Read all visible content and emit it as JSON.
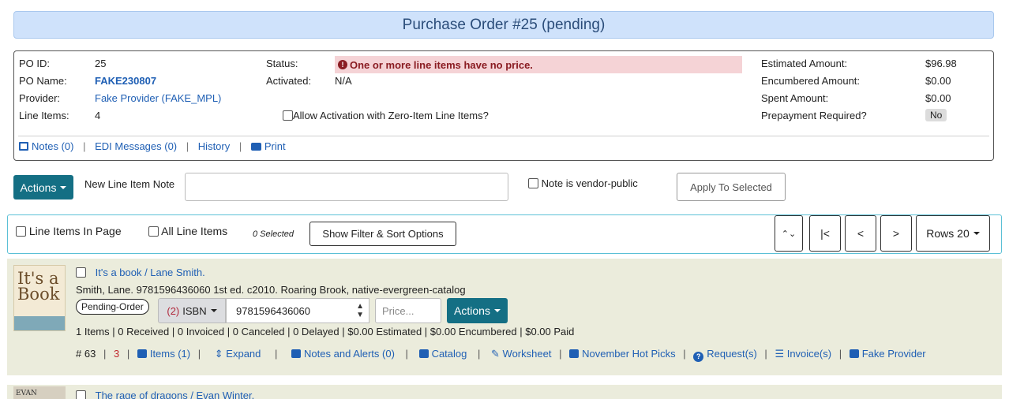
{
  "header": {
    "title": "Purchase Order #25 (pending)"
  },
  "summary": {
    "po_id_label": "PO ID:",
    "po_id": "25",
    "po_name_label": "PO Name:",
    "po_name": "FAKE230807",
    "provider_label": "Provider:",
    "provider": "Fake Provider (FAKE_MPL)",
    "line_items_label": "Line Items:",
    "line_items": "4",
    "status_label": "Status:",
    "status_alert": "One or more line items have no price.",
    "activated_label": "Activated:",
    "activated": "N/A",
    "allow_zero_label": "Allow Activation with Zero-Item Line Items?",
    "estimated_label": "Estimated Amount:",
    "estimated": "$96.98",
    "encumbered_label": "Encumbered Amount:",
    "encumbered": "$0.00",
    "spent_label": "Spent Amount:",
    "spent": "$0.00",
    "prepay_label": "Prepayment Required?",
    "prepay": "No",
    "links": {
      "notes": "Notes (0)",
      "edi": "EDI Messages (0)",
      "history": "History",
      "print": "Print"
    }
  },
  "actions_bar": {
    "actions_label": "Actions",
    "note_label": "New Line Item Note",
    "vendor_public_label": "Note is vendor-public",
    "apply_label": "Apply To Selected"
  },
  "toolbar": {
    "line_items_in_page": "Line Items In Page",
    "all_line_items": "All Line Items",
    "selected": "0 Selected",
    "filter_btn": "Show Filter & Sort Options",
    "expand_glyph": "⌃⌄",
    "first_glyph": "|<",
    "prev_glyph": "<",
    "next_glyph": ">",
    "rows_label": "Rows 20"
  },
  "line_items": [
    {
      "title": "It's a book / Lane Smith.",
      "cover_text": "It's a Book",
      "details": "Smith, Lane. 9781596436060  1st ed. c2010. Roaring Brook, native-evergreen-catalog",
      "state": "Pending-Order",
      "isbn_count": "(2)",
      "isbn_type": "ISBN",
      "isbn_value": "9781596436060",
      "price_placeholder": "Price...",
      "actions_label": "Actions",
      "stats": "1 Items  |  0 Received  |  0 Invoiced  |  0 Canceled  |  0 Delayed  |  $0.00 Estimated  |  $0.00 Encumbered  |  $0.00 Paid",
      "li_id": "# 63",
      "li_count": "3",
      "items_link": "Items (1)",
      "expand_link": "Expand",
      "notes_link": "Notes and Alerts (0)",
      "catalog_link": "Catalog",
      "worksheet_link": "Worksheet",
      "hot_picks_link": "November Hot Picks",
      "requests_link": "Request(s)",
      "invoices_link": "Invoice(s)",
      "provider_link": "Fake Provider"
    },
    {
      "title": "The rage of dragons / Evan Winter.",
      "cover_text": "EVAN WINTER"
    }
  ],
  "colors": {
    "accent": "#146f84",
    "link": "#1f5fb4",
    "alert_bg": "#f5d3d6",
    "row_bg": "#ebecdc",
    "header_bg": "#cfe2fb"
  }
}
